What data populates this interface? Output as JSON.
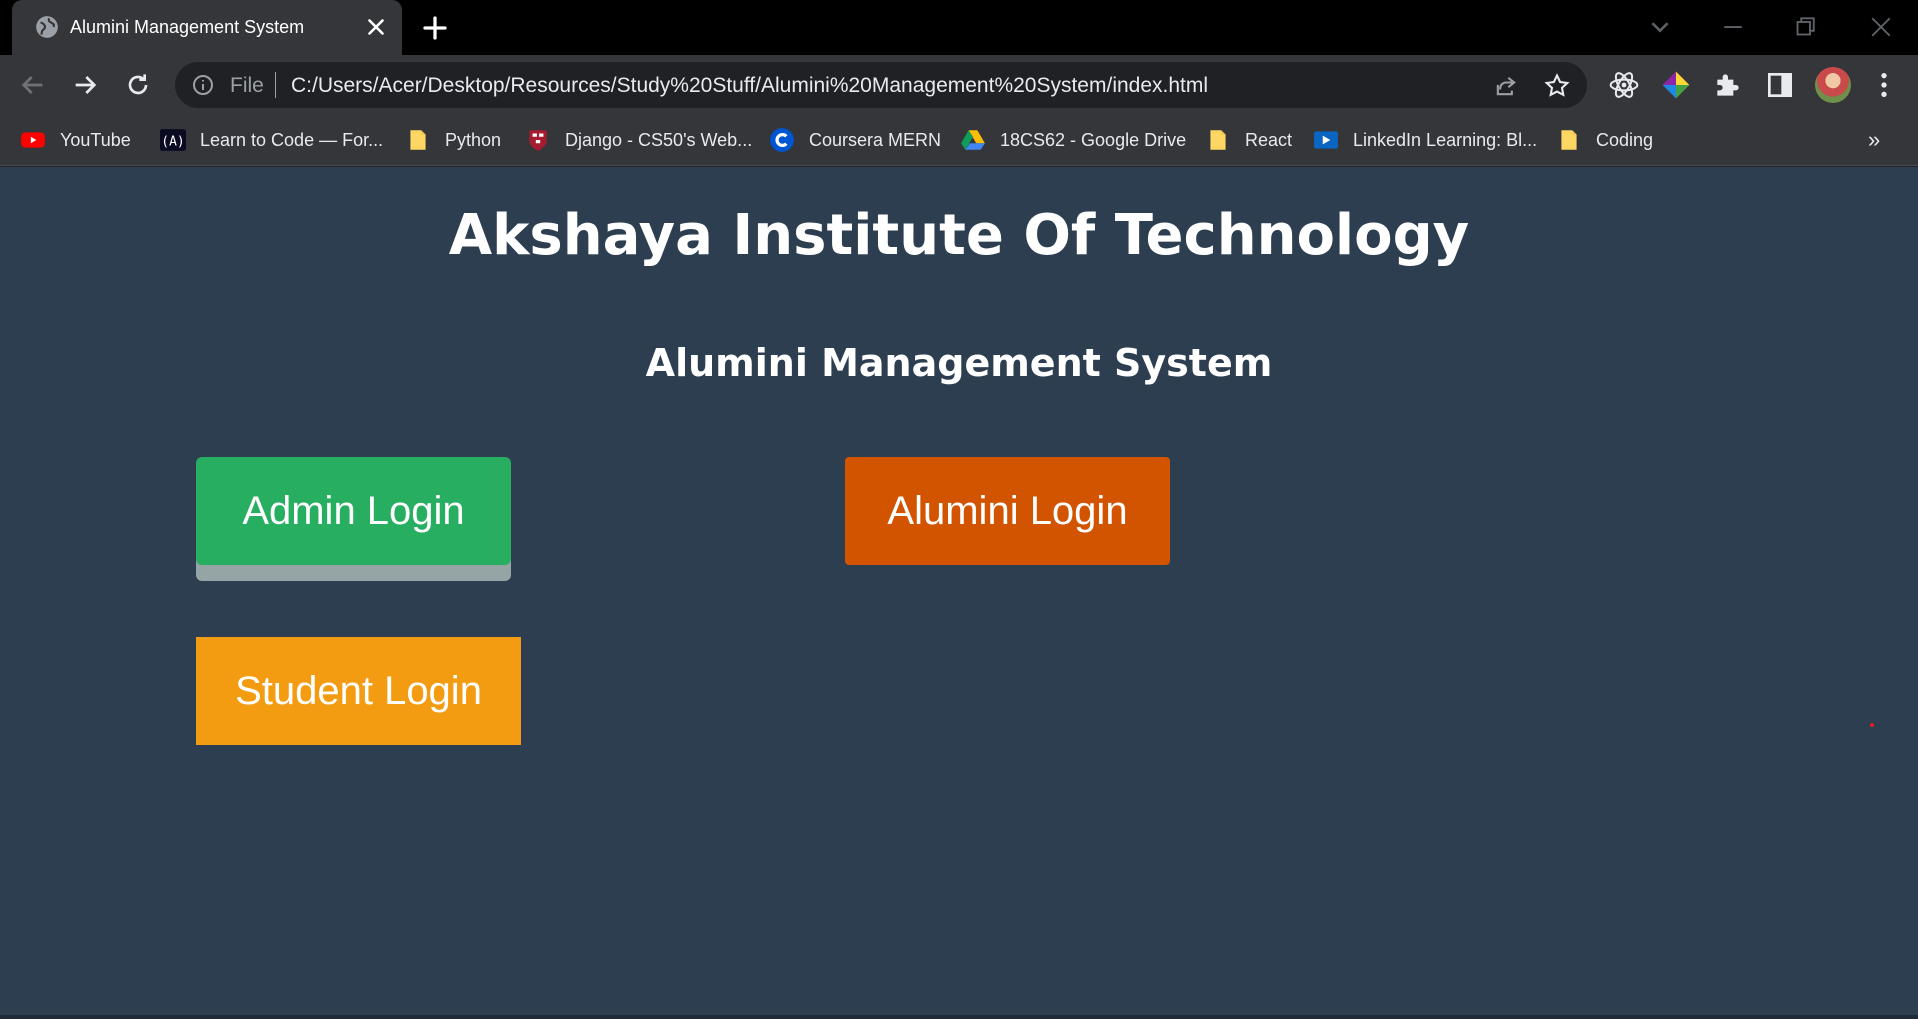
{
  "browser": {
    "tab_title": "Alumini Management System",
    "address": {
      "scheme": "File",
      "url": "C:/Users/Acer/Desktop/Resources/Study%20Stuff/Alumini%20Management%20System/index.html"
    },
    "bookmarks": [
      {
        "label": "YouTube",
        "icon": "youtube-icon"
      },
      {
        "label": "Learn to Code — For...",
        "icon": "freecodecamp-icon"
      },
      {
        "label": "Python",
        "icon": "folder-icon"
      },
      {
        "label": "Django - CS50's Web...",
        "icon": "harvard-icon"
      },
      {
        "label": "Coursera MERN",
        "icon": "coursera-icon"
      },
      {
        "label": "18CS62 - Google Drive",
        "icon": "google-drive-icon"
      },
      {
        "label": "React",
        "icon": "folder-icon"
      },
      {
        "label": "LinkedIn Learning: Bl...",
        "icon": "linkedin-learning-icon"
      },
      {
        "label": "Coding",
        "icon": "folder-icon"
      }
    ],
    "bookmarks_overflow": "»"
  },
  "page": {
    "heading": "Akshaya Institute Of Technology",
    "subheading": "Alumini Management System",
    "buttons": {
      "admin": "Admin Login",
      "alumni": "Alumini Login",
      "student": "Student Login"
    }
  },
  "colors": {
    "page_background": "#2c3e50",
    "admin_button": "#27ae60",
    "alumni_button": "#d35400",
    "student_button": "#f39c12"
  }
}
